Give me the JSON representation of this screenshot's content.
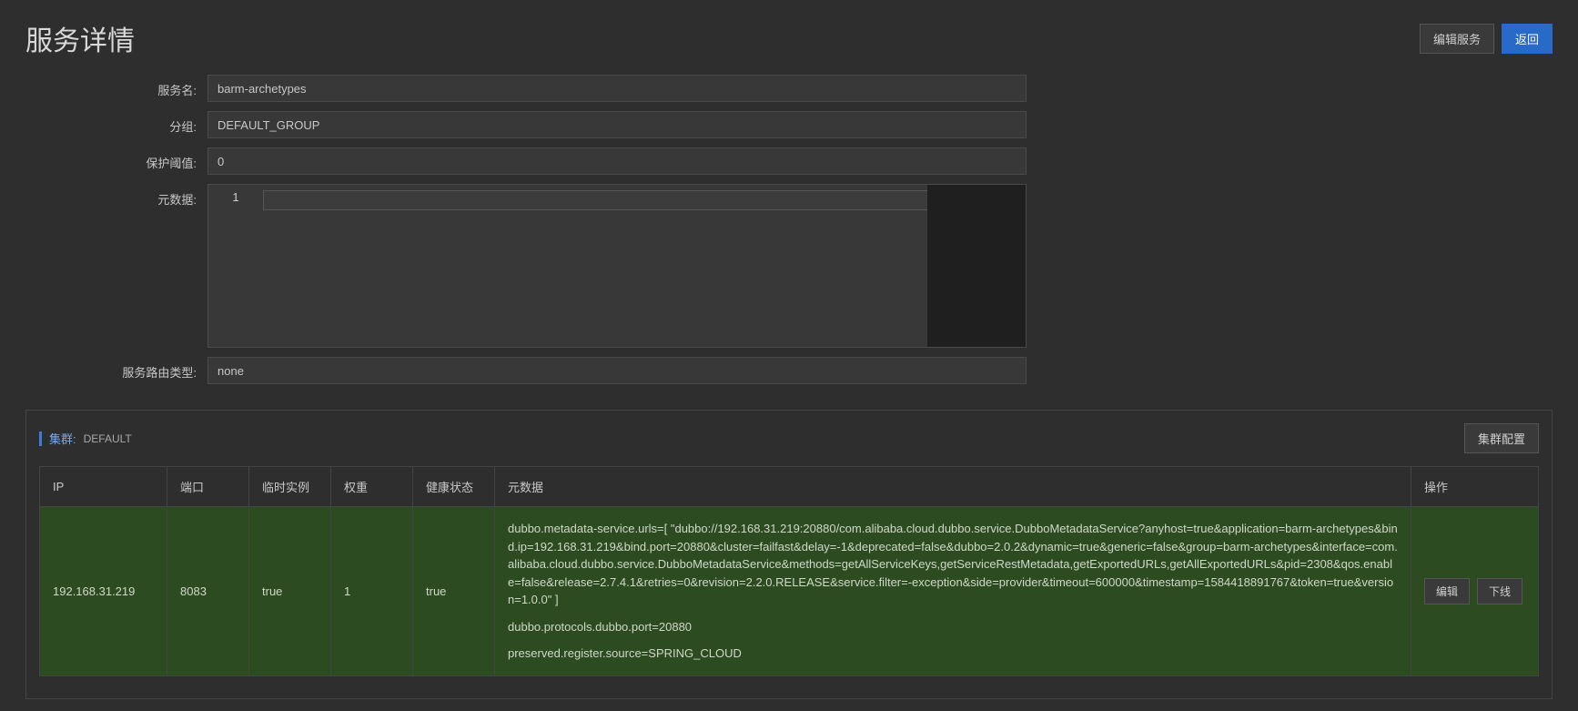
{
  "header": {
    "title": "服务详情",
    "edit_button": "编辑服务",
    "back_button": "返回"
  },
  "form": {
    "service_name_label": "服务名:",
    "service_name_value": "barm-archetypes",
    "group_label": "分组:",
    "group_value": "DEFAULT_GROUP",
    "threshold_label": "保护阈值:",
    "threshold_value": "0",
    "metadata_label": "元数据:",
    "metadata_index": "1",
    "route_type_label": "服务路由类型:",
    "route_type_value": "none"
  },
  "cluster": {
    "label": "集群:",
    "name": "DEFAULT",
    "config_button": "集群配置",
    "columns": {
      "ip": "IP",
      "port": "端口",
      "ephemeral": "临时实例",
      "weight": "权重",
      "health": "健康状态",
      "metadata": "元数据",
      "action": "操作"
    },
    "rows": [
      {
        "ip": "192.168.31.219",
        "port": "8083",
        "ephemeral": "true",
        "weight": "1",
        "health": "true",
        "metadata": [
          "dubbo.metadata-service.urls=[ \"dubbo://192.168.31.219:20880/com.alibaba.cloud.dubbo.service.DubboMetadataService?anyhost=true&application=barm-archetypes&bind.ip=192.168.31.219&bind.port=20880&cluster=failfast&delay=-1&deprecated=false&dubbo=2.0.2&dynamic=true&generic=false&group=barm-archetypes&interface=com.alibaba.cloud.dubbo.service.DubboMetadataService&methods=getAllServiceKeys,getServiceRestMetadata,getExportedURLs,getAllExportedURLs&pid=2308&qos.enable=false&release=2.7.4.1&retries=0&revision=2.2.0.RELEASE&service.filter=-exception&side=provider&timeout=600000&timestamp=1584418891767&token=true&version=1.0.0\" ]",
          "dubbo.protocols.dubbo.port=20880",
          "preserved.register.source=SPRING_CLOUD"
        ],
        "edit": "编辑",
        "offline": "下线"
      }
    ]
  }
}
